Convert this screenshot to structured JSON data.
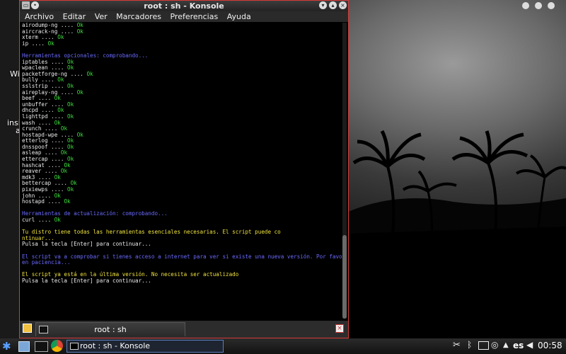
{
  "window": {
    "title": "root : sh - Konsole",
    "menu": [
      "Archivo",
      "Editar",
      "Ver",
      "Marcadores",
      "Preferencias",
      "Ayuda"
    ],
    "tab_label": "root : sh"
  },
  "terminal": {
    "lines": [
      {
        "text": "airodump-ng .... ",
        "ok": "Ok"
      },
      {
        "text": "aircrack-ng .... ",
        "ok": "Ok"
      },
      {
        "text": "xterm .... ",
        "ok": "Ok"
      },
      {
        "text": "ip .... ",
        "ok": "Ok"
      },
      {
        "text": ""
      },
      {
        "text": "Herramientas opcionales: comprobando...",
        "style": "blue"
      },
      {
        "text": "iptables .... ",
        "ok": "Ok"
      },
      {
        "text": "wpaclean .... ",
        "ok": "Ok"
      },
      {
        "text": "packetforge-ng .... ",
        "ok": "Ok"
      },
      {
        "text": "bully .... ",
        "ok": "Ok"
      },
      {
        "text": "sslstrip .... ",
        "ok": "Ok"
      },
      {
        "text": "aireplay-ng .... ",
        "ok": "Ok"
      },
      {
        "text": "beef .... ",
        "ok": "Ok"
      },
      {
        "text": "unbuffer .... ",
        "ok": "Ok"
      },
      {
        "text": "dhcpd .... ",
        "ok": "Ok"
      },
      {
        "text": "lighttpd .... ",
        "ok": "Ok"
      },
      {
        "text": "wash .... ",
        "ok": "Ok"
      },
      {
        "text": "crunch .... ",
        "ok": "Ok"
      },
      {
        "text": "hostapd-wpe .... ",
        "ok": "Ok"
      },
      {
        "text": "etterlog .... ",
        "ok": "Ok"
      },
      {
        "text": "dnsspoof .... ",
        "ok": "Ok"
      },
      {
        "text": "asleap .... ",
        "ok": "Ok"
      },
      {
        "text": "ettercap .... ",
        "ok": "Ok"
      },
      {
        "text": "hashcat .... ",
        "ok": "Ok"
      },
      {
        "text": "reaver .... ",
        "ok": "Ok"
      },
      {
        "text": "mdk3 .... ",
        "ok": "Ok"
      },
      {
        "text": "bettercap .... ",
        "ok": "Ok"
      },
      {
        "text": "pixiewps .... ",
        "ok": "Ok"
      },
      {
        "text": "john .... ",
        "ok": "Ok"
      },
      {
        "text": "hostapd .... ",
        "ok": "Ok"
      },
      {
        "text": ""
      },
      {
        "text": "Herramientas de actualización: comprobando...",
        "style": "blue"
      },
      {
        "text": "curl .... ",
        "ok": "Ok"
      },
      {
        "text": ""
      },
      {
        "text": "Tu distro tiene todas las herramientas esenciales necesarias. El script puede co",
        "style": "yellow"
      },
      {
        "text": "ntinuar...",
        "style": "yellow"
      },
      {
        "text": "Pulsa la tecla [Enter] para continuar..."
      },
      {
        "text": ""
      },
      {
        "text": "El script va a comprobar si tienes acceso a internet para ver si existe una nueva versión. Por favor t",
        "style": "blue"
      },
      {
        "text": "en paciencia...",
        "style": "blue"
      },
      {
        "text": ""
      },
      {
        "text": "El script ya está en la última versión. No necesita ser actualizado",
        "style": "yellow"
      },
      {
        "text": "Pulsa la tecla [Enter] para continuar..."
      }
    ]
  },
  "desktop": {
    "icon_labels": [
      "Wi",
      "insi",
      "a"
    ]
  },
  "taskbar": {
    "task_label": "root : sh - Konsole",
    "language": "es",
    "clock": "00:58"
  },
  "colors": {
    "ok": "#3ee03e",
    "blue": "#6a6aff",
    "yellow": "#f0e23c",
    "window_border": "#d93a3a"
  }
}
